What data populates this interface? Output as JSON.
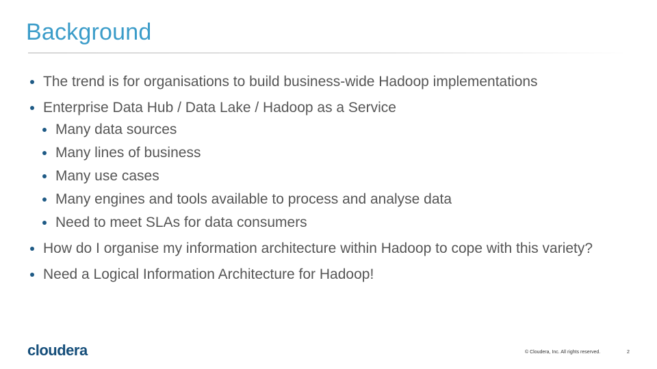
{
  "slide": {
    "title": "Background",
    "bullets": [
      {
        "text": "The trend is for organisations to build business-wide Hadoop implementations"
      },
      {
        "text": "Enterprise Data Hub / Data Lake / Hadoop as a Service",
        "children": [
          "Many data sources",
          "Many lines of business",
          "Many use cases",
          "Many engines and tools available to process and analyse data",
          "Need to meet SLAs for data consumers"
        ]
      },
      {
        "text": "How do I organise my information architecture within Hadoop to cope with this variety?"
      },
      {
        "text": "Need a Logical Information Architecture for Hadoop!"
      }
    ]
  },
  "footer": {
    "logo": "cloudera",
    "copyright": "© Cloudera, Inc. All rights reserved.",
    "page_number": "2"
  },
  "colors": {
    "title": "#3b9cc9",
    "bullet": "#1e5a85",
    "body_text": "#555555",
    "logo": "#154e7a"
  }
}
